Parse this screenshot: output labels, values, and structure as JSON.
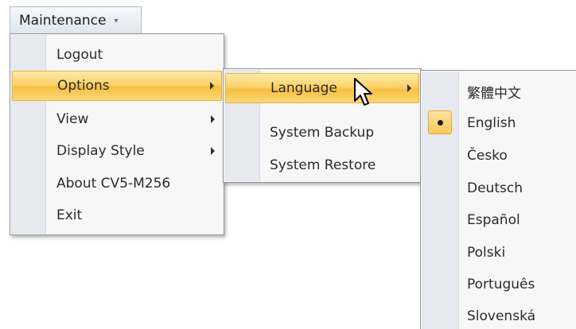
{
  "menubar": {
    "maintenance_label": "Maintenance",
    "dropdown_glyph": "▾"
  },
  "main_menu": {
    "items": [
      {
        "label": "Logout"
      },
      {
        "label": "Options"
      },
      {
        "label": "View"
      },
      {
        "label": "Display Style"
      },
      {
        "label": "About CV5-M256"
      },
      {
        "label": "Exit"
      }
    ]
  },
  "options_menu": {
    "items": [
      {
        "label": "Language"
      },
      {
        "label": "System Backup"
      },
      {
        "label": "System Restore"
      }
    ]
  },
  "language_menu": {
    "selected": "English",
    "items": [
      {
        "label": "繁體中文"
      },
      {
        "label": "English"
      },
      {
        "label": "Česko"
      },
      {
        "label": "Deutsch"
      },
      {
        "label": "Español"
      },
      {
        "label": "Polski"
      },
      {
        "label": "Português"
      },
      {
        "label": "Slovenská"
      }
    ]
  },
  "colors": {
    "highlight": "#fbd36b",
    "gutter": "#e6e9ee",
    "menu_bg": "#f7f7f7",
    "border": "#979797"
  }
}
